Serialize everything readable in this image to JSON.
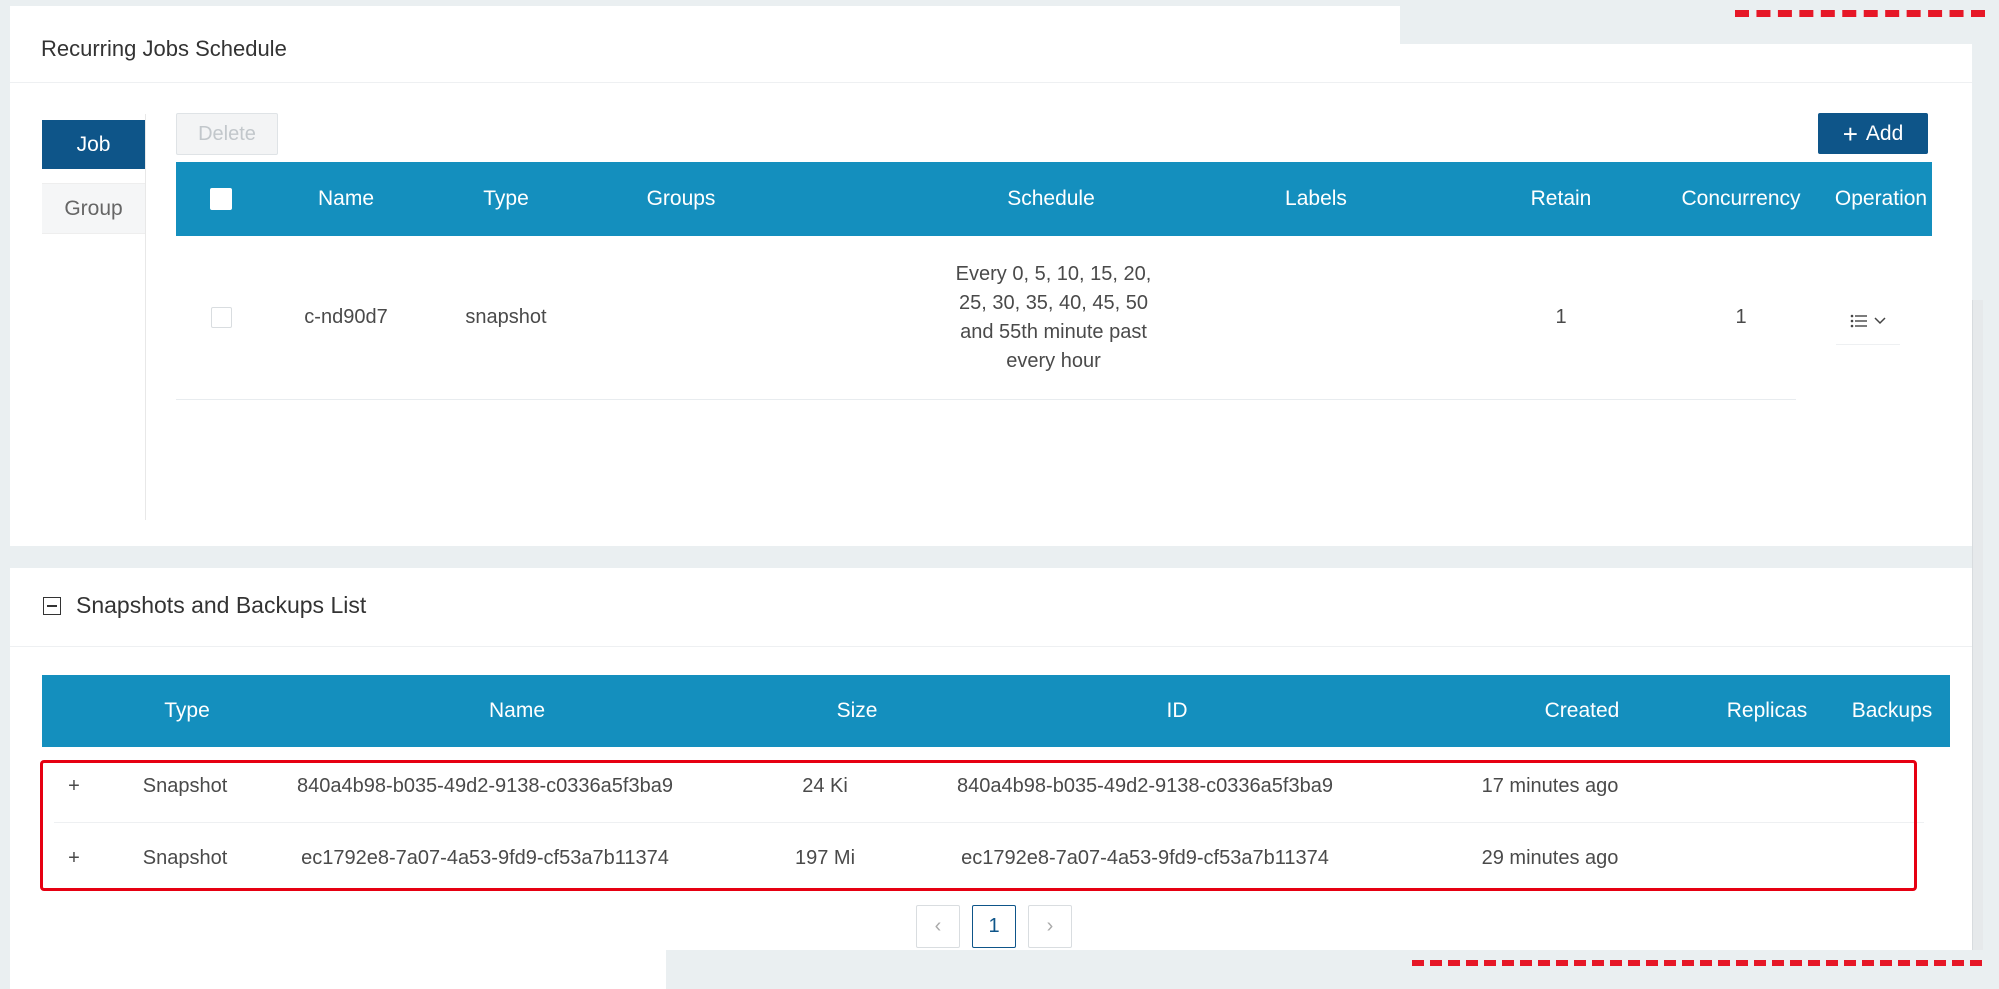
{
  "jobs": {
    "title": "Recurring Jobs Schedule",
    "tabs": [
      {
        "label": "Job"
      },
      {
        "label": "Group"
      }
    ],
    "delete_label": "Delete",
    "add_label": "Add",
    "columns": [
      "Name",
      "Type",
      "Groups",
      "Schedule",
      "Labels",
      "Retain",
      "Concurrency",
      "Operation"
    ],
    "rows": [
      {
        "name": "c-nd90d7",
        "type": "snapshot",
        "groups": "",
        "schedule": "Every 0, 5, 10, 15, 20, 25, 30, 35, 40, 45, 50 and 55th minute past every hour",
        "labels": "",
        "retain": "1",
        "concurrency": "1"
      }
    ]
  },
  "backups": {
    "title": "Snapshots and Backups List",
    "columns": [
      "Type",
      "Name",
      "Size",
      "ID",
      "Created",
      "Replicas",
      "Backups"
    ],
    "rows": [
      {
        "expand": "+",
        "type": "Snapshot",
        "name": "840a4b98-b035-49d2-9138-c0336a5f3ba9",
        "size": "24 Ki",
        "id": "840a4b98-b035-49d2-9138-c0336a5f3ba9",
        "created": "17 minutes ago"
      },
      {
        "expand": "+",
        "type": "Snapshot",
        "name": "ec1792e8-7a07-4a53-9fd9-cf53a7b11374",
        "size": "197 Mi",
        "id": "ec1792e8-7a07-4a53-9fd9-cf53a7b11374",
        "created": "29 minutes ago"
      }
    ],
    "pagination": {
      "prev": "‹",
      "current": "1",
      "next": "›"
    }
  },
  "colors": {
    "primary": "#0e5589",
    "table_header": "#148fbe",
    "highlight": "#e60012"
  },
  "icons": {
    "operation": "list-menu-icon",
    "collapse": "collapse-icon",
    "add": "plus-icon"
  }
}
